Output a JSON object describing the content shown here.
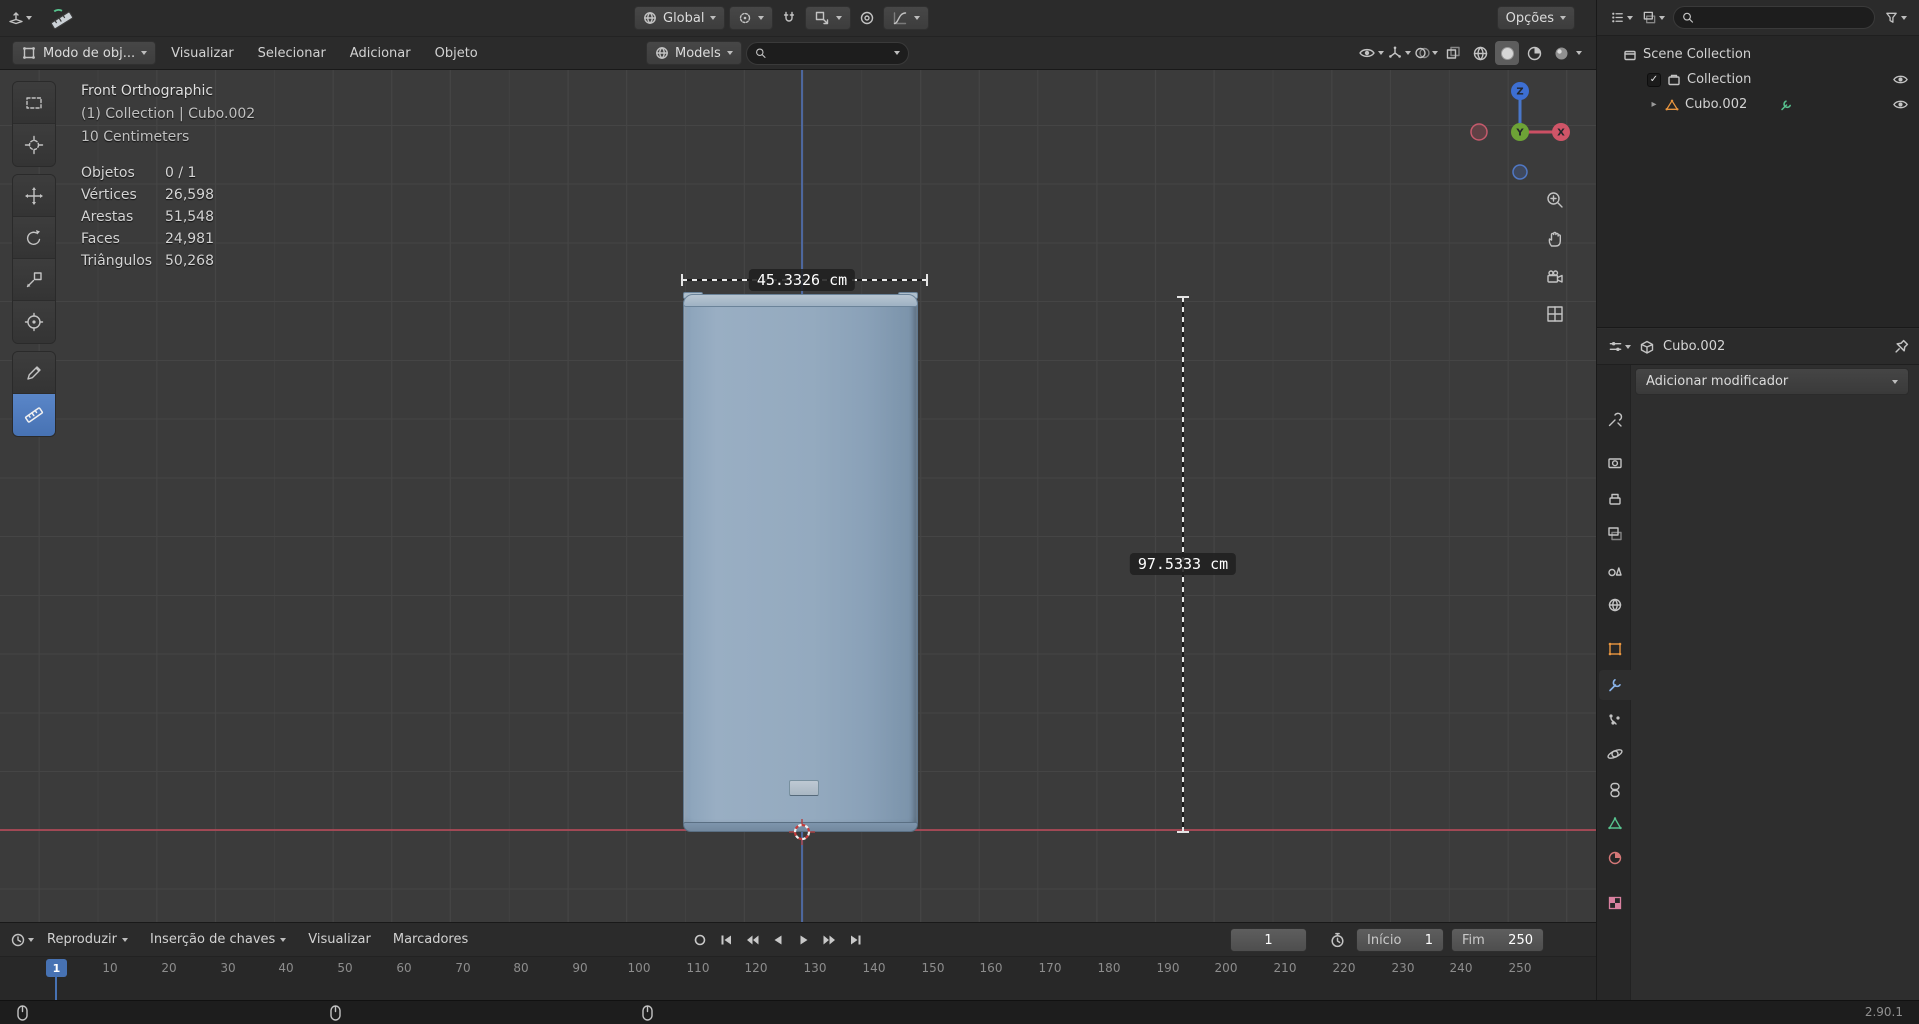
{
  "tool_settings": {
    "orientation_label": "Global",
    "options_label": "Opções"
  },
  "viewport_header": {
    "mode_label": "Modo de obj...",
    "menu_view": "Visualizar",
    "menu_select": "Selecionar",
    "menu_add": "Adicionar",
    "menu_object": "Objeto",
    "asset_label": "Models",
    "search_placeholder": ""
  },
  "viewport": {
    "view_label": "Front Orthographic",
    "context_label": "(1) Collection | Cubo.002",
    "unit_label": "10 Centimeters",
    "stats": [
      {
        "label": "Objetos",
        "value": "0 / 1"
      },
      {
        "label": "Vértices",
        "value": "26,598"
      },
      {
        "label": "Arestas",
        "value": "51,548"
      },
      {
        "label": "Faces",
        "value": "24,981"
      },
      {
        "label": "Triângulos",
        "value": "50,268"
      }
    ],
    "measure_width_label": "45.3326 cm",
    "measure_height_label": "97.5333 cm",
    "gizmo_x": "X",
    "gizmo_y": "Y",
    "gizmo_z": "Z"
  },
  "outliner": {
    "scene_collection_label": "Scene Collection",
    "collection_label": "Collection",
    "object_label": "Cubo.002"
  },
  "properties": {
    "breadcrumb_object": "Cubo.002",
    "add_modifier_label": "Adicionar modificador"
  },
  "timeline": {
    "playback_label": "Reproduzir",
    "keying_label": "Inserção de chaves",
    "view_label": "Visualizar",
    "markers_label": "Marcadores",
    "current_frame": "1",
    "playhead_label": "1",
    "start_label": "Início",
    "start_value": "1",
    "end_label": "Fim",
    "end_value": "250",
    "ticks": [
      "10",
      "20",
      "30",
      "40",
      "50",
      "60",
      "70",
      "80",
      "90",
      "100",
      "110",
      "120",
      "130",
      "140",
      "150",
      "160",
      "170",
      "180",
      "190",
      "200",
      "210",
      "220",
      "230",
      "240",
      "250"
    ]
  },
  "status_bar": {
    "version_label": "2.90.1"
  },
  "colors": {
    "accent_blue": "#4772b3",
    "object_blue": "#8ba3ba",
    "axis_x_red": "#a84a58",
    "axis_z_blue": "#4b6cad"
  }
}
